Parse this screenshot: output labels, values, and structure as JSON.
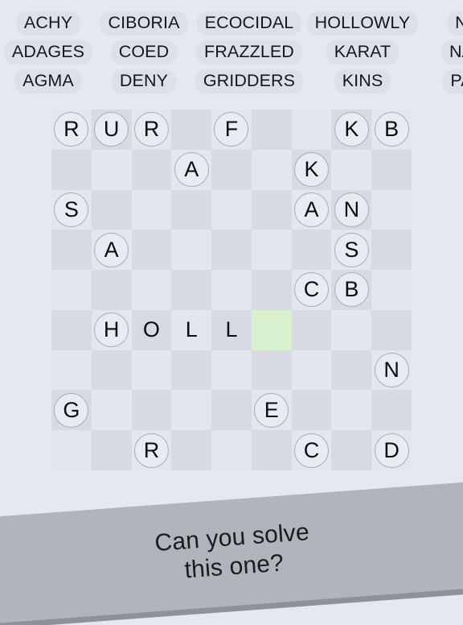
{
  "background_color": "#e5e8ef",
  "word_list": {
    "columns": [
      {
        "words": [
          "ACHY",
          "ADAGES",
          "AGMA"
        ]
      },
      {
        "words": [
          "CIBORIA",
          "COED",
          "DENY"
        ]
      },
      {
        "words": [
          "ECOCIDAL",
          "FRAZZLED",
          "GRIDDERS"
        ]
      },
      {
        "words": [
          "HOLLOWLY",
          "KARAT",
          "KINS"
        ]
      },
      {
        "words": [
          "N",
          "NA",
          "PA"
        ]
      }
    ]
  },
  "board": {
    "rows": 9,
    "columns": 9,
    "active_cell": {
      "row": 5,
      "col": 5,
      "color": "#d8f0cd"
    },
    "light_color": "#e3e6ed",
    "dark_color": "#d7dae3",
    "tile_border_color": "#a9adb7",
    "cells": [
      [
        {
          "letter": "R",
          "type": "tile"
        },
        {
          "letter": "U",
          "type": "tile"
        },
        {
          "letter": "R",
          "type": "tile"
        },
        {
          "letter": "",
          "type": "empty"
        },
        {
          "letter": "F",
          "type": "tile"
        },
        {
          "letter": "",
          "type": "empty"
        },
        {
          "letter": "",
          "type": "empty"
        },
        {
          "letter": "K",
          "type": "tile"
        },
        {
          "letter": "B",
          "type": "tile"
        }
      ],
      [
        {
          "letter": "",
          "type": "empty"
        },
        {
          "letter": "",
          "type": "empty"
        },
        {
          "letter": "",
          "type": "empty"
        },
        {
          "letter": "A",
          "type": "tile"
        },
        {
          "letter": "",
          "type": "empty"
        },
        {
          "letter": "",
          "type": "empty"
        },
        {
          "letter": "K",
          "type": "tile"
        },
        {
          "letter": "",
          "type": "empty"
        },
        {
          "letter": "",
          "type": "empty"
        }
      ],
      [
        {
          "letter": "S",
          "type": "tile"
        },
        {
          "letter": "",
          "type": "empty"
        },
        {
          "letter": "",
          "type": "empty"
        },
        {
          "letter": "",
          "type": "empty"
        },
        {
          "letter": "",
          "type": "empty"
        },
        {
          "letter": "",
          "type": "empty"
        },
        {
          "letter": "A",
          "type": "tile"
        },
        {
          "letter": "N",
          "type": "tile"
        },
        {
          "letter": "",
          "type": "empty"
        }
      ],
      [
        {
          "letter": "",
          "type": "empty"
        },
        {
          "letter": "A",
          "type": "tile"
        },
        {
          "letter": "",
          "type": "empty"
        },
        {
          "letter": "",
          "type": "empty"
        },
        {
          "letter": "",
          "type": "empty"
        },
        {
          "letter": "",
          "type": "empty"
        },
        {
          "letter": "",
          "type": "empty"
        },
        {
          "letter": "S",
          "type": "tile"
        },
        {
          "letter": "",
          "type": "empty"
        }
      ],
      [
        {
          "letter": "",
          "type": "empty"
        },
        {
          "letter": "",
          "type": "empty"
        },
        {
          "letter": "",
          "type": "empty"
        },
        {
          "letter": "",
          "type": "empty"
        },
        {
          "letter": "",
          "type": "empty"
        },
        {
          "letter": "",
          "type": "empty"
        },
        {
          "letter": "C",
          "type": "tile"
        },
        {
          "letter": "B",
          "type": "tile"
        },
        {
          "letter": "",
          "type": "empty"
        }
      ],
      [
        {
          "letter": "",
          "type": "empty"
        },
        {
          "letter": "H",
          "type": "tile"
        },
        {
          "letter": "O",
          "type": "bare"
        },
        {
          "letter": "L",
          "type": "bare"
        },
        {
          "letter": "L",
          "type": "bare"
        },
        {
          "letter": "",
          "type": "active"
        },
        {
          "letter": "",
          "type": "empty"
        },
        {
          "letter": "",
          "type": "empty"
        },
        {
          "letter": "",
          "type": "empty"
        }
      ],
      [
        {
          "letter": "",
          "type": "empty"
        },
        {
          "letter": "",
          "type": "empty"
        },
        {
          "letter": "",
          "type": "empty"
        },
        {
          "letter": "",
          "type": "empty"
        },
        {
          "letter": "",
          "type": "empty"
        },
        {
          "letter": "",
          "type": "empty"
        },
        {
          "letter": "",
          "type": "empty"
        },
        {
          "letter": "",
          "type": "empty"
        },
        {
          "letter": "N",
          "type": "tile"
        }
      ],
      [
        {
          "letter": "G",
          "type": "tile"
        },
        {
          "letter": "",
          "type": "empty"
        },
        {
          "letter": "",
          "type": "empty"
        },
        {
          "letter": "",
          "type": "empty"
        },
        {
          "letter": "",
          "type": "empty"
        },
        {
          "letter": "E",
          "type": "tile"
        },
        {
          "letter": "",
          "type": "empty"
        },
        {
          "letter": "",
          "type": "empty"
        },
        {
          "letter": "",
          "type": "empty"
        }
      ],
      [
        {
          "letter": "",
          "type": "empty"
        },
        {
          "letter": "",
          "type": "empty"
        },
        {
          "letter": "R",
          "type": "tile"
        },
        {
          "letter": "",
          "type": "empty"
        },
        {
          "letter": "",
          "type": "empty"
        },
        {
          "letter": "",
          "type": "empty"
        },
        {
          "letter": "C",
          "type": "tile"
        },
        {
          "letter": "",
          "type": "empty"
        },
        {
          "letter": "D",
          "type": "tile"
        }
      ]
    ]
  },
  "banner": {
    "line1": "Can you solve",
    "line2": "this one?",
    "background_color": "#b0b4bb",
    "shadow_color": "#8d9199"
  }
}
